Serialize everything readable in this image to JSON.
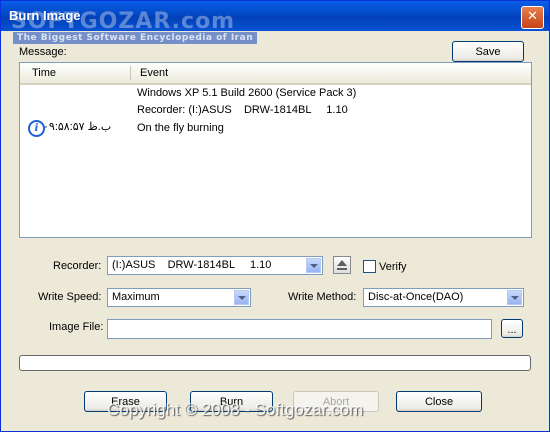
{
  "window": {
    "title": "Burn Image",
    "close_label": "✕"
  },
  "watermark": {
    "logo": "SOFTGOZAR.com",
    "tagline": "The Biggest Software Encyclopedia of Iran",
    "copyright": "Copyright © 2008 - Softgozar.com"
  },
  "message": {
    "label": "Message:",
    "save_label": "Save",
    "columns": {
      "time": "Time",
      "event": "Event"
    },
    "lines": [
      "Windows XP 5.1 Build 2600 (Service Pack 3)",
      "Recorder: (I:)ASUS    DRW-1814BL     1.10",
      "On the fly burning"
    ],
    "entry_time": "ب.ظ ۰۹:۵۸:۵۷",
    "entry_icon": "info-icon"
  },
  "form": {
    "recorder_label": "Recorder:",
    "recorder_value": "(I:)ASUS    DRW-1814BL     1.10",
    "verify_label": "Verify",
    "verify_checked": false,
    "write_speed_label": "Write Speed:",
    "write_speed_value": "Maximum",
    "write_method_label": "Write Method:",
    "write_method_value": "Disc-at-Once(DAO)",
    "image_file_label": "Image File:",
    "image_file_value": "",
    "browse_label": "..."
  },
  "progress": {
    "value": 0
  },
  "buttons": {
    "erase": "Erase",
    "burn": "Burn",
    "abort": "Abort",
    "close": "Close"
  },
  "colors": {
    "titlebar": "#0348c4",
    "accent": "#003c74",
    "progress_fill": "#2fbf2f"
  }
}
